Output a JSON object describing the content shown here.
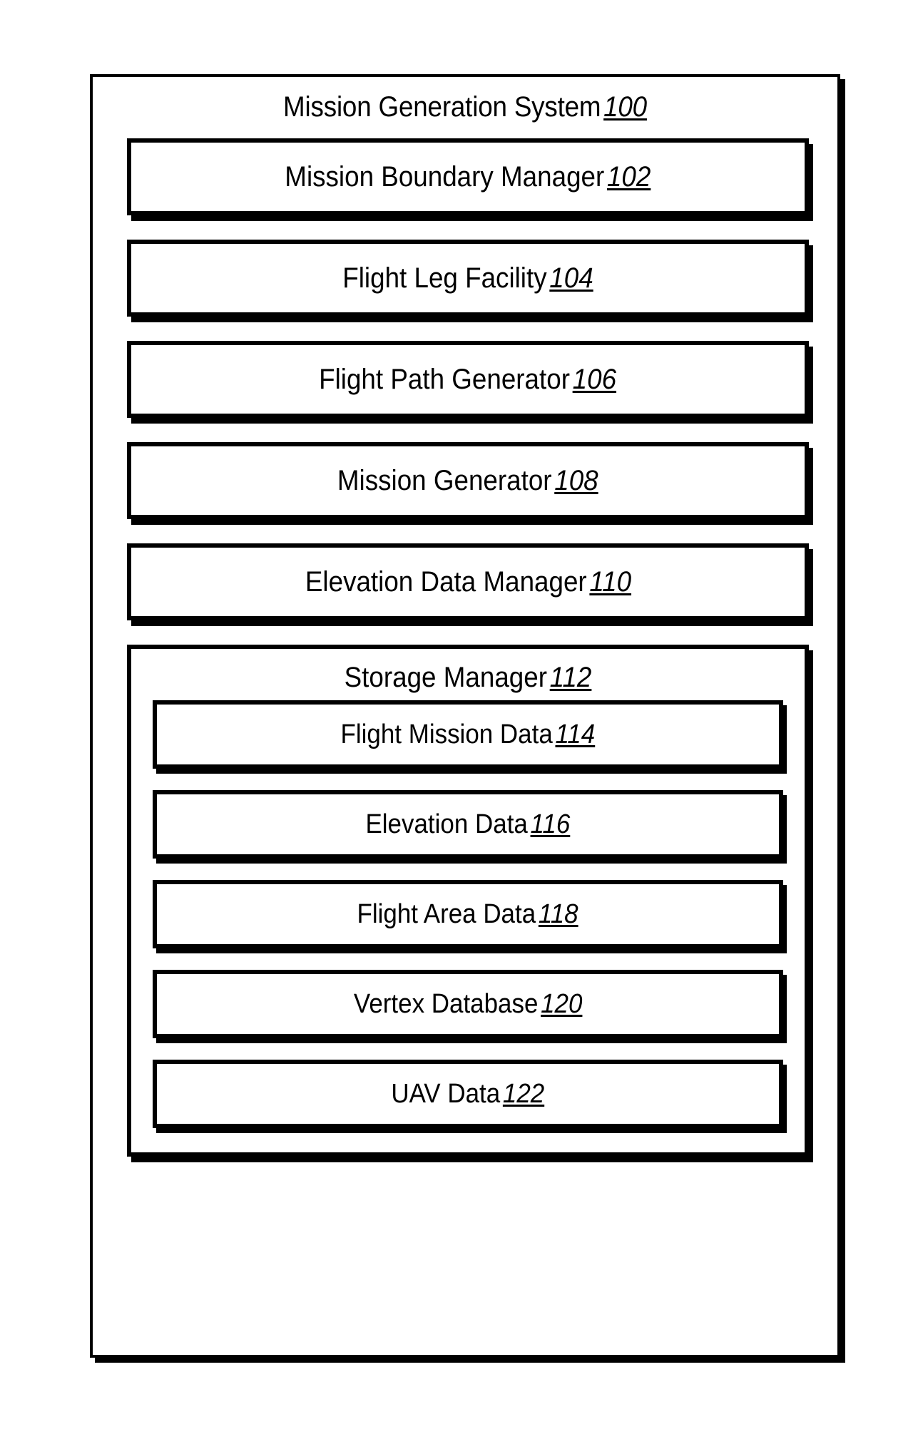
{
  "diagram": {
    "type": "patent-block-diagram",
    "system": {
      "title": "Mission Generation System",
      "ref": "100"
    },
    "modules": [
      {
        "label": "Mission Boundary Manager",
        "ref": "102"
      },
      {
        "label": "Flight Leg Facility",
        "ref": "104"
      },
      {
        "label": "Flight Path Generator",
        "ref": "106"
      },
      {
        "label": "Mission Generator",
        "ref": "108"
      },
      {
        "label": "Elevation Data Manager",
        "ref": "110"
      }
    ],
    "storage_manager": {
      "label": "Storage Manager",
      "ref": "112",
      "items": [
        {
          "label": "Flight Mission Data",
          "ref": "114"
        },
        {
          "label": "Elevation Data",
          "ref": "116"
        },
        {
          "label": "Flight Area Data",
          "ref": "118"
        },
        {
          "label": "Vertex Database",
          "ref": "120"
        },
        {
          "label": "UAV Data",
          "ref": "122"
        }
      ]
    },
    "colors": {
      "stroke": "#000000",
      "fill": "#ffffff",
      "text": "#000000"
    }
  }
}
